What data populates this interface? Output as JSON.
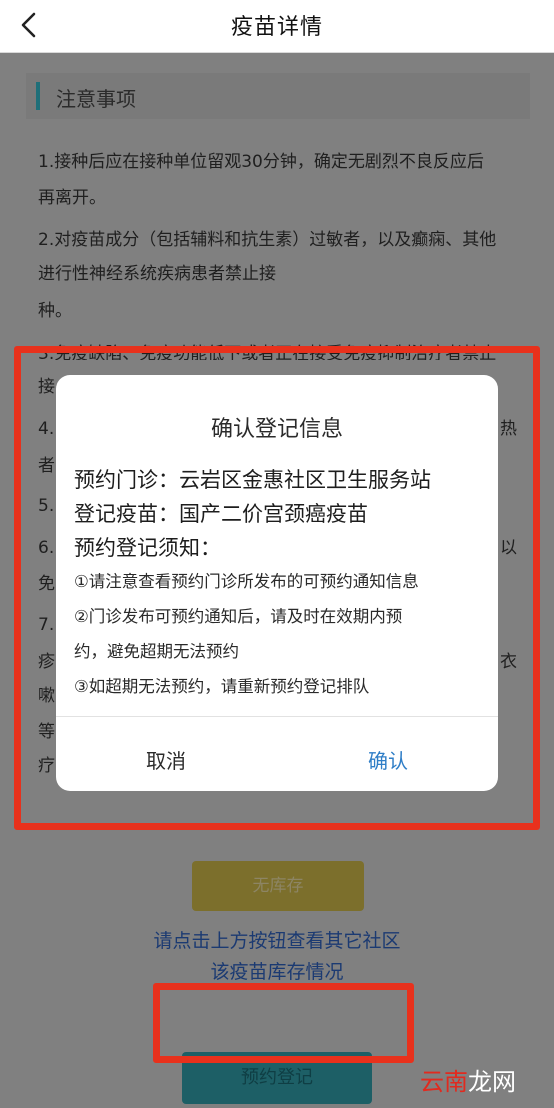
{
  "header": {
    "title": "疫苗详情"
  },
  "section": {
    "title": "注意事项"
  },
  "notice_lines": [
    "1.接种后应在接种单位留观30分钟，确定无剧烈不良反应后",
    "再离开。",
    "2.对疫苗成分（包括辅料和抗生素）过敏者，以及癫痫、其他",
    "进行性神经系统疾病患者禁止接",
    "种。",
    "3.免疫缺陷、免疫功能低下或者正在接受免疫抑制治疗者禁止",
    "接"
  ],
  "behind_fragments": [
    {
      "left": "4.",
      "right": "热"
    },
    {
      "left": "者",
      "right": ""
    },
    {
      "left": "5.",
      "right": ""
    },
    {
      "left": "6.",
      "right": "以"
    },
    {
      "left": "免",
      "right": ""
    },
    {
      "left": "7.",
      "right": ""
    },
    {
      "left": "疹",
      "right": "衣"
    },
    {
      "left": "嗽",
      "right": ""
    },
    {
      "left": "等",
      "right": ""
    },
    {
      "left": "疗",
      "right": ""
    }
  ],
  "modal": {
    "title": "确认登记信息",
    "clinic_line": "预约门诊：云岩区金惠社区卫生服务站",
    "vaccine_line": "登记疫苗：国产二价宫颈癌疫苗",
    "notice_heading": "预约登记须知：",
    "notice_items": [
      "①请注意查看预约门诊所发布的可预约通知信息",
      "②门诊发布可预约通知后，请及时在效期内预",
      "约，避免超期无法预约",
      "③如超期无法预约，请重新预约登记排队"
    ],
    "cancel_label": "取消",
    "confirm_label": "确认"
  },
  "bottom": {
    "stock_label": "无库存",
    "hint_line1": "请点击上方按钮查看其它社区",
    "hint_line2": "该疫苗库存情况",
    "reserve_label": "预约登记"
  },
  "watermark": {
    "part1": "云南",
    "part2": "龙网"
  },
  "colors": {
    "highlight": "#e8311c",
    "confirm": "#2f7ec7",
    "accent_bar": "#1f6f79"
  }
}
